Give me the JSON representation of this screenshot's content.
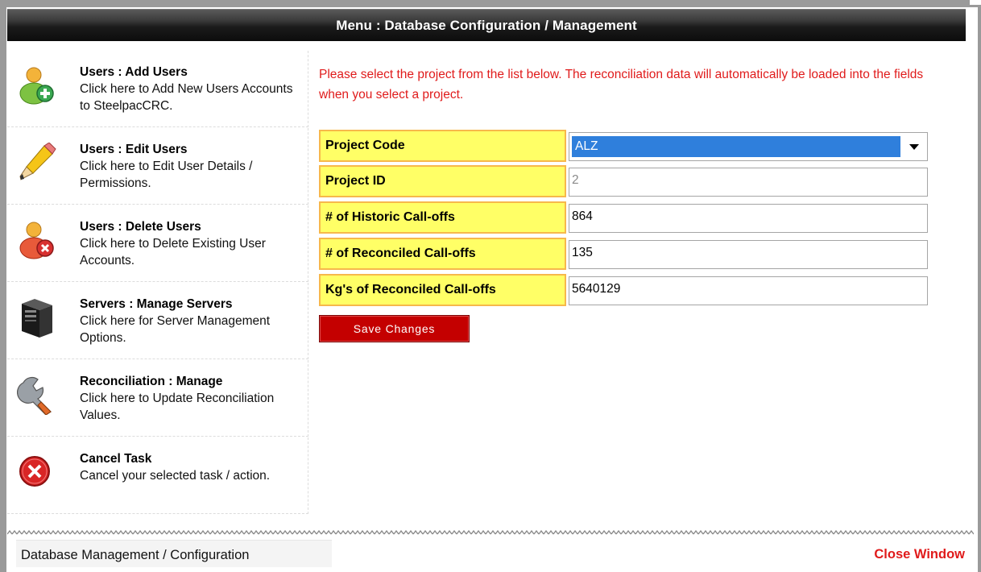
{
  "window": {
    "title": "Menu : Database Configuration / Management"
  },
  "menu": {
    "items": [
      {
        "title": "Users : Add Users",
        "description": "Click here to Add New Users Accounts to SteelpacCRC.",
        "icon": "add-user-icon"
      },
      {
        "title": "Users : Edit Users",
        "description": "Click here to Edit User Details / Permissions.",
        "icon": "pencil-icon"
      },
      {
        "title": "Users : Delete Users",
        "description": "Click here to Delete Existing User Accounts.",
        "icon": "delete-user-icon"
      },
      {
        "title": "Servers : Manage Servers",
        "description": "Click here for Server Management Options.",
        "icon": "server-icon"
      },
      {
        "title": "Reconciliation : Manage",
        "description": "Click here to Update Reconciliation Values.",
        "icon": "wrench-icon"
      },
      {
        "title": "Cancel Task",
        "description": "Cancel your selected task / action.",
        "icon": "cancel-icon"
      }
    ]
  },
  "main": {
    "instructions": "Please select the project from the list below. The reconciliation data will automatically be loaded into the fields when you select a project.",
    "fields": {
      "project_code": {
        "label": "Project Code",
        "value": "ALZ"
      },
      "project_id": {
        "label": "Project ID",
        "value": "2"
      },
      "historic_calloffs": {
        "label": "# of Historic Call-offs",
        "value": "864"
      },
      "reconciled_calloffs": {
        "label": "# of Reconciled Call-offs",
        "value": "135"
      },
      "kg_reconciled_calloffs": {
        "label": "Kg's of Reconciled Call-offs",
        "value": "5640129"
      }
    },
    "save_label": "Save Changes"
  },
  "footer": {
    "left_text": "Database Management / Configuration",
    "close_label": "Close Window"
  },
  "colors": {
    "title_bar": "#111111",
    "label_bg": "#ffff66",
    "label_border": "#f7b84b",
    "accent_red": "#e01b1b",
    "button_red": "#c40000",
    "select_highlight": "#2f7fdc"
  }
}
